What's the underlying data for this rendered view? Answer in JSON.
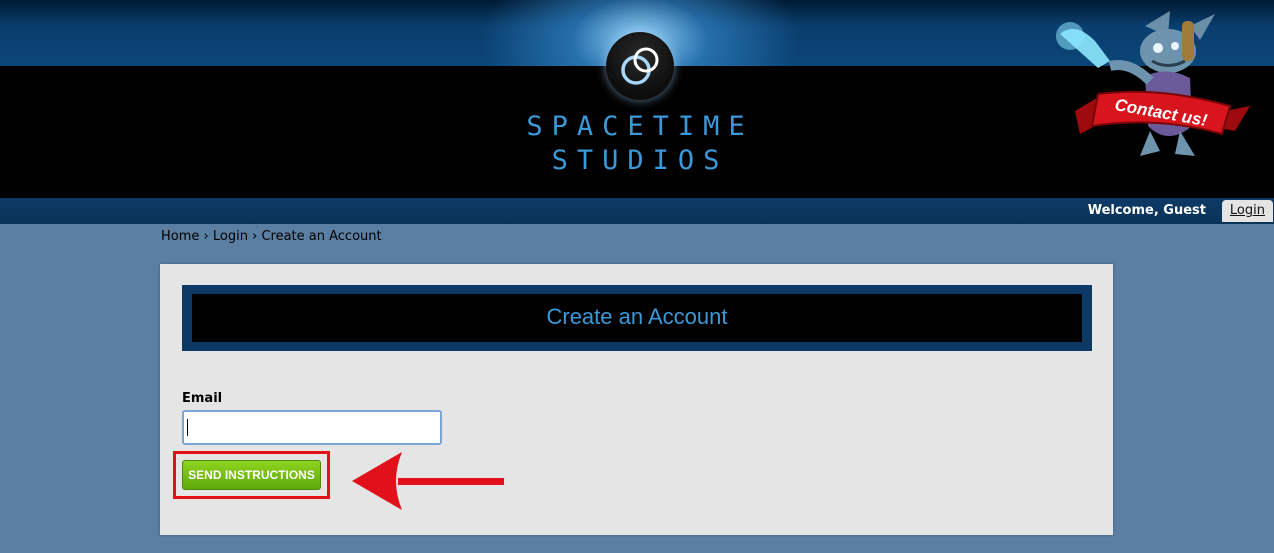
{
  "header": {
    "brand_line1": "SPACETIME",
    "brand_line2": "STUDIOS",
    "contact_banner": "Contact us!"
  },
  "navbar": {
    "welcome": "Welcome, Guest",
    "login_label": "Login"
  },
  "breadcrumb": {
    "items": [
      "Home",
      "Login",
      "Create an Account"
    ],
    "separator": "›"
  },
  "form": {
    "title": "Create an Account",
    "email_label": "Email",
    "email_value": "",
    "submit_label": "SEND INSTRUCTIONS"
  },
  "colors": {
    "accent_blue": "#3a9ad9",
    "button_green": "#6fbc12",
    "annotation_red": "#e1101a"
  }
}
